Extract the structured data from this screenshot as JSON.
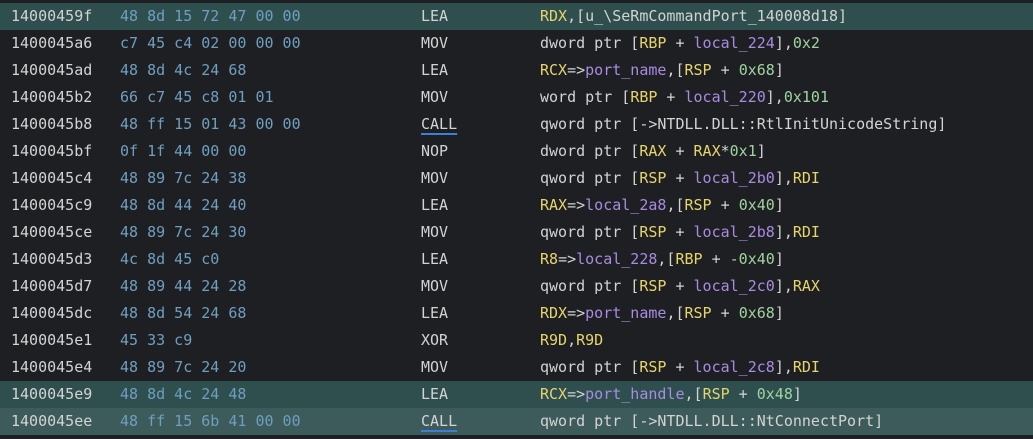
{
  "colors": {
    "background": "#1e1f22",
    "highlight_row": "#2f4f4f",
    "address": "#d3d3d3",
    "bytes": "#6f9fc0",
    "register": "#e6d46e",
    "number": "#9fd49f",
    "variable": "#a98be0",
    "call_underline": "#3f7ed6"
  },
  "rows": [
    {
      "address": "14000459f",
      "bytes": "48 8d 15 72 47 00 00",
      "mnemonic": "LEA",
      "call": false,
      "highlight": "hl",
      "operands": [
        {
          "t": "RDX",
          "k": "reg"
        },
        {
          "t": ",[u_\\SeRmCommandPort_140008d18]",
          "k": "plain"
        }
      ]
    },
    {
      "address": "1400045a6",
      "bytes": "c7 45 c4 02 00 00 00",
      "mnemonic": "MOV",
      "call": false,
      "highlight": "",
      "operands": [
        {
          "t": "dword ptr [",
          "k": "plain"
        },
        {
          "t": "RBP",
          "k": "reg"
        },
        {
          "t": " + ",
          "k": "plain"
        },
        {
          "t": "local_224",
          "k": "var"
        },
        {
          "t": "],",
          "k": "plain"
        },
        {
          "t": "0x2",
          "k": "num"
        }
      ]
    },
    {
      "address": "1400045ad",
      "bytes": "48 8d 4c 24 68",
      "mnemonic": "LEA",
      "call": false,
      "highlight": "",
      "operands": [
        {
          "t": "RCX",
          "k": "reg"
        },
        {
          "t": "=>",
          "k": "plain"
        },
        {
          "t": "port_name",
          "k": "var"
        },
        {
          "t": ",[",
          "k": "plain"
        },
        {
          "t": "RSP",
          "k": "reg"
        },
        {
          "t": " + ",
          "k": "plain"
        },
        {
          "t": "0x68",
          "k": "num"
        },
        {
          "t": "]",
          "k": "plain"
        }
      ]
    },
    {
      "address": "1400045b2",
      "bytes": "66 c7 45 c8 01 01",
      "mnemonic": "MOV",
      "call": false,
      "highlight": "",
      "operands": [
        {
          "t": "word ptr [",
          "k": "plain"
        },
        {
          "t": "RBP",
          "k": "reg"
        },
        {
          "t": " + ",
          "k": "plain"
        },
        {
          "t": "local_220",
          "k": "var"
        },
        {
          "t": "],",
          "k": "plain"
        },
        {
          "t": "0x101",
          "k": "num"
        }
      ]
    },
    {
      "address": "1400045b8",
      "bytes": "48 ff 15 01 43 00 00",
      "mnemonic": "CALL",
      "call": true,
      "highlight": "",
      "operands": [
        {
          "t": "qword ptr [->NTDLL.DLL::RtlInitUnicodeString]",
          "k": "plain"
        }
      ]
    },
    {
      "address": "1400045bf",
      "bytes": "0f 1f 44 00 00",
      "mnemonic": "NOP",
      "call": false,
      "highlight": "",
      "operands": [
        {
          "t": "dword ptr [",
          "k": "plain"
        },
        {
          "t": "RAX",
          "k": "reg"
        },
        {
          "t": " + ",
          "k": "plain"
        },
        {
          "t": "RAX",
          "k": "reg"
        },
        {
          "t": "*",
          "k": "plain"
        },
        {
          "t": "0x1",
          "k": "num"
        },
        {
          "t": "]",
          "k": "plain"
        }
      ]
    },
    {
      "address": "1400045c4",
      "bytes": "48 89 7c 24 38",
      "mnemonic": "MOV",
      "call": false,
      "highlight": "",
      "operands": [
        {
          "t": "qword ptr [",
          "k": "plain"
        },
        {
          "t": "RSP",
          "k": "reg"
        },
        {
          "t": " + ",
          "k": "plain"
        },
        {
          "t": "local_2b0",
          "k": "var"
        },
        {
          "t": "],",
          "k": "plain"
        },
        {
          "t": "RDI",
          "k": "reg"
        }
      ]
    },
    {
      "address": "1400045c9",
      "bytes": "48 8d 44 24 40",
      "mnemonic": "LEA",
      "call": false,
      "highlight": "",
      "operands": [
        {
          "t": "RAX",
          "k": "reg"
        },
        {
          "t": "=>",
          "k": "plain"
        },
        {
          "t": "local_2a8",
          "k": "var"
        },
        {
          "t": ",[",
          "k": "plain"
        },
        {
          "t": "RSP",
          "k": "reg"
        },
        {
          "t": " + ",
          "k": "plain"
        },
        {
          "t": "0x40",
          "k": "num"
        },
        {
          "t": "]",
          "k": "plain"
        }
      ]
    },
    {
      "address": "1400045ce",
      "bytes": "48 89 7c 24 30",
      "mnemonic": "MOV",
      "call": false,
      "highlight": "",
      "operands": [
        {
          "t": "qword ptr [",
          "k": "plain"
        },
        {
          "t": "RSP",
          "k": "reg"
        },
        {
          "t": " + ",
          "k": "plain"
        },
        {
          "t": "local_2b8",
          "k": "var"
        },
        {
          "t": "],",
          "k": "plain"
        },
        {
          "t": "RDI",
          "k": "reg"
        }
      ]
    },
    {
      "address": "1400045d3",
      "bytes": "4c 8d 45 c0",
      "mnemonic": "LEA",
      "call": false,
      "highlight": "",
      "operands": [
        {
          "t": "R8",
          "k": "reg"
        },
        {
          "t": "=>",
          "k": "plain"
        },
        {
          "t": "local_228",
          "k": "var"
        },
        {
          "t": ",[",
          "k": "plain"
        },
        {
          "t": "RBP",
          "k": "reg"
        },
        {
          "t": " + ",
          "k": "plain"
        },
        {
          "t": "-0x40",
          "k": "num"
        },
        {
          "t": "]",
          "k": "plain"
        }
      ]
    },
    {
      "address": "1400045d7",
      "bytes": "48 89 44 24 28",
      "mnemonic": "MOV",
      "call": false,
      "highlight": "",
      "operands": [
        {
          "t": "qword ptr [",
          "k": "plain"
        },
        {
          "t": "RSP",
          "k": "reg"
        },
        {
          "t": " + ",
          "k": "plain"
        },
        {
          "t": "local_2c0",
          "k": "var"
        },
        {
          "t": "],",
          "k": "plain"
        },
        {
          "t": "RAX",
          "k": "reg"
        }
      ]
    },
    {
      "address": "1400045dc",
      "bytes": "48 8d 54 24 68",
      "mnemonic": "LEA",
      "call": false,
      "highlight": "",
      "operands": [
        {
          "t": "RDX",
          "k": "reg"
        },
        {
          "t": "=>",
          "k": "plain"
        },
        {
          "t": "port_name",
          "k": "var"
        },
        {
          "t": ",[",
          "k": "plain"
        },
        {
          "t": "RSP",
          "k": "reg"
        },
        {
          "t": " + ",
          "k": "plain"
        },
        {
          "t": "0x68",
          "k": "num"
        },
        {
          "t": "]",
          "k": "plain"
        }
      ]
    },
    {
      "address": "1400045e1",
      "bytes": "45 33 c9",
      "mnemonic": "XOR",
      "call": false,
      "highlight": "",
      "operands": [
        {
          "t": "R9D",
          "k": "reg"
        },
        {
          "t": ",",
          "k": "plain"
        },
        {
          "t": "R9D",
          "k": "reg"
        }
      ]
    },
    {
      "address": "1400045e4",
      "bytes": "48 89 7c 24 20",
      "mnemonic": "MOV",
      "call": false,
      "highlight": "",
      "operands": [
        {
          "t": "qword ptr [",
          "k": "plain"
        },
        {
          "t": "RSP",
          "k": "reg"
        },
        {
          "t": " + ",
          "k": "plain"
        },
        {
          "t": "local_2c8",
          "k": "var"
        },
        {
          "t": "],",
          "k": "plain"
        },
        {
          "t": "RDI",
          "k": "reg"
        }
      ]
    },
    {
      "address": "1400045e9",
      "bytes": "48 8d 4c 24 48",
      "mnemonic": "LEA",
      "call": false,
      "highlight": "hl",
      "operands": [
        {
          "t": "RCX",
          "k": "reg"
        },
        {
          "t": "=>",
          "k": "plain"
        },
        {
          "t": "port_handle",
          "k": "var"
        },
        {
          "t": ",[",
          "k": "plain"
        },
        {
          "t": "RSP",
          "k": "reg"
        },
        {
          "t": " + ",
          "k": "plain"
        },
        {
          "t": "0x48",
          "k": "num"
        },
        {
          "t": "]",
          "k": "plain"
        }
      ]
    },
    {
      "address": "1400045ee",
      "bytes": "48 ff 15 6b 41 00 00",
      "mnemonic": "CALL",
      "call": true,
      "highlight": "hl-strong",
      "operands": [
        {
          "t": "qword ptr [->NTDLL.DLL::NtConnectPort]",
          "k": "plain"
        }
      ]
    }
  ]
}
